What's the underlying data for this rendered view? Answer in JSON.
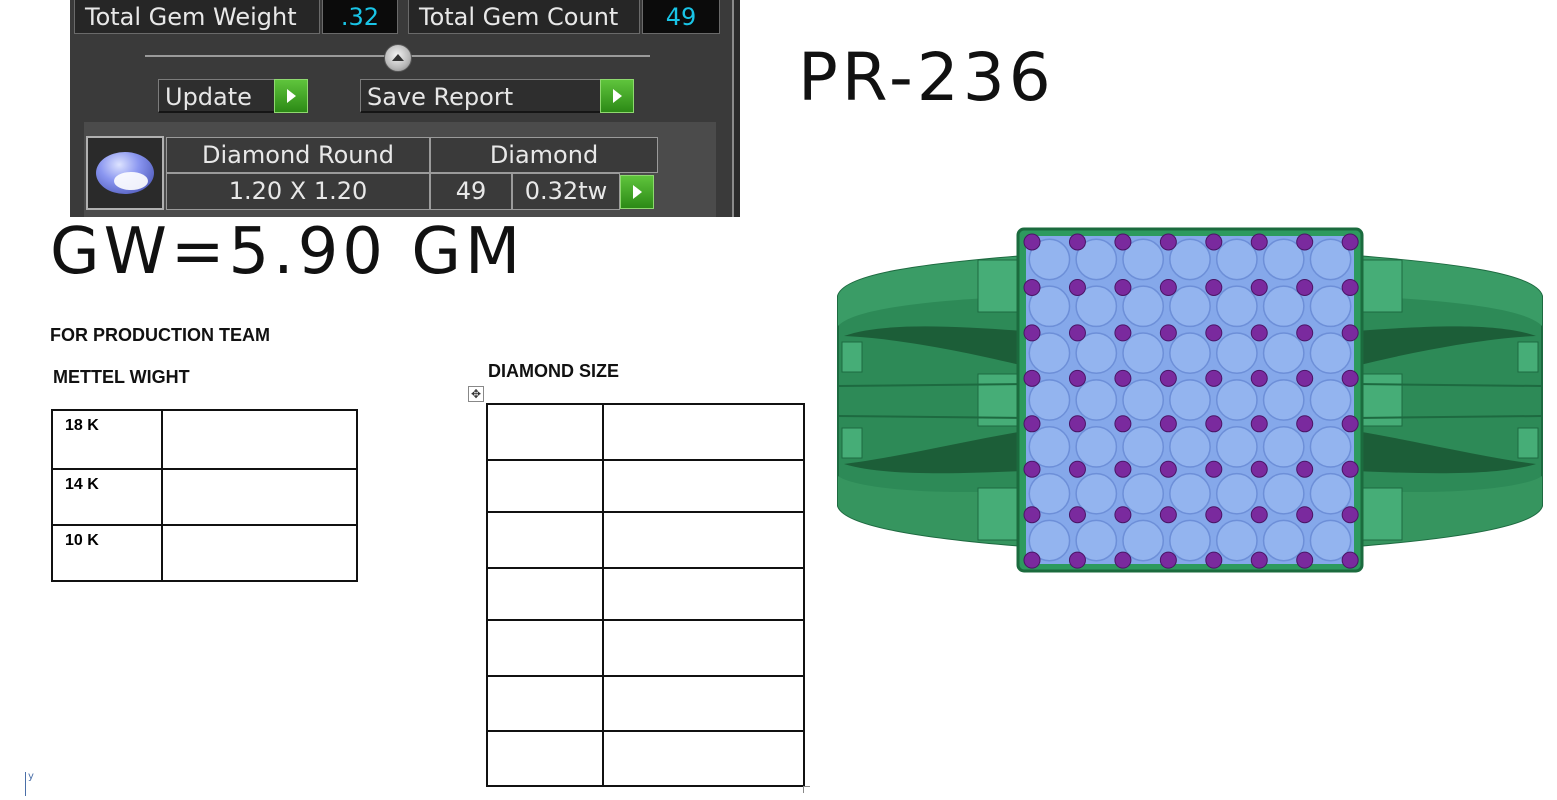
{
  "gem_panel": {
    "total_weight_label": "Total Gem Weight",
    "total_weight_value": ".32",
    "total_count_label": "Total Gem Count",
    "total_count_value": "49",
    "update_label": "Update",
    "save_report_label": "Save Report",
    "gem_shape": "Diamond Round",
    "gem_type": "Diamond",
    "gem_size": "1.20 X 1.20",
    "gem_count": "49",
    "gem_weight": "0.32tw",
    "colors": {
      "panel_bg": "#3a3a3a",
      "value_text": "#19c4e6",
      "play_green": "#3ea825"
    }
  },
  "design_code": "PR-236",
  "gross_weight": "GW=5.90 GM",
  "production": {
    "heading": "FOR PRODUCTION TEAM",
    "metal_heading": "METTEL WIGHT",
    "metal_rows": [
      {
        "karat": "18 K",
        "value": ""
      },
      {
        "karat": "14 K",
        "value": ""
      },
      {
        "karat": "10 K",
        "value": ""
      }
    ],
    "diamond_heading": "DIAMOND SIZE",
    "diamond_rows": [
      [
        "",
        ""
      ],
      [
        "",
        ""
      ],
      [
        "",
        ""
      ],
      [
        "",
        ""
      ],
      [
        "",
        ""
      ],
      [
        "",
        ""
      ],
      [
        "",
        ""
      ]
    ]
  },
  "render": {
    "metal_color": "#2f8f5c",
    "large_stone_color": "#93b4ef",
    "small_stone_color": "#7a2a9e",
    "icons": [
      "move-handle-icon",
      "text-cursor-icon"
    ]
  }
}
